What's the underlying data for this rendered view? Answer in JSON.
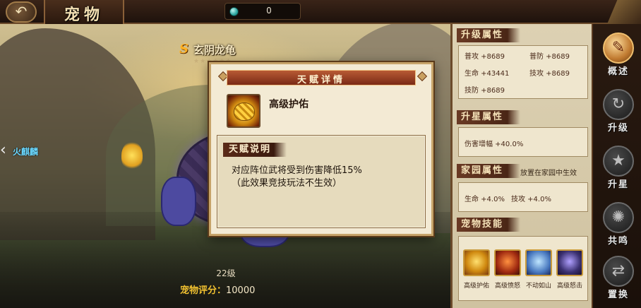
{
  "topbar": {
    "back_icon": "back-arrow-icon",
    "title": "宠物",
    "currency": {
      "icon": "gem-icon",
      "value": "0"
    }
  },
  "pet": {
    "grade": "S",
    "name": "玄阴龙龟",
    "stars": "★★★★★★",
    "prev_pet": "火麒麟",
    "level": "22级",
    "score_label": "宠物评分：",
    "score_value": "10000"
  },
  "panel": {
    "upgrade": {
      "title": "升级属性",
      "stats": [
        "普攻 +8689",
        "普防 +8689",
        "生命 +43441",
        "技攻 +8689",
        "技防 +8689"
      ]
    },
    "star": {
      "title": "升星属性",
      "stats": [
        "伤害增幅 +40.0%"
      ]
    },
    "home": {
      "title": "家园属性",
      "note": "放置在家园中生效",
      "stats": [
        "生命 +4.0%",
        "技攻 +4.0%"
      ]
    },
    "skills": {
      "title": "宠物技能",
      "items": [
        "高级护佑",
        "高级愤怒",
        "不动如山",
        "高级怒击"
      ]
    }
  },
  "tabs": [
    {
      "label": "概述",
      "icon": "scroll-icon",
      "active": true
    },
    {
      "label": "升级",
      "icon": "upgrade-icon",
      "active": false
    },
    {
      "label": "升星",
      "icon": "star-icon",
      "active": false
    },
    {
      "label": "共鸣",
      "icon": "resonance-icon",
      "active": false
    },
    {
      "label": "置换",
      "icon": "swap-icon",
      "active": false
    }
  ],
  "dialog": {
    "title": "天赋详情",
    "talent_name": "高级护佑",
    "desc_label": "天赋说明",
    "desc_lines": [
      "对应阵位武将受到伤害降低15%",
      "（此效果竞技玩法不生效）"
    ]
  }
}
